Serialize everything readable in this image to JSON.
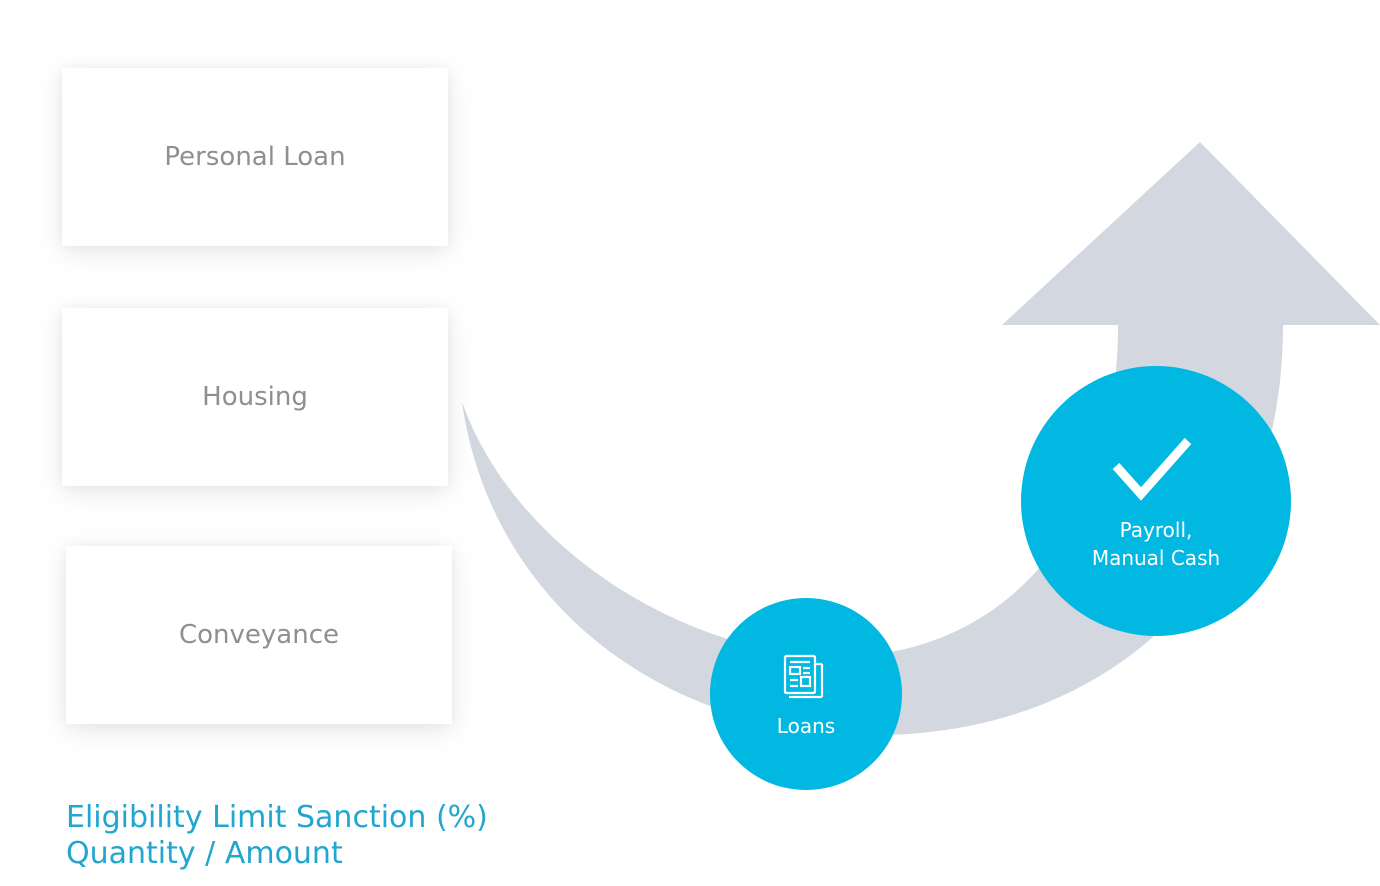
{
  "cards": [
    {
      "label": "Personal Loan"
    },
    {
      "label": "Housing"
    },
    {
      "label": "Conveyance"
    }
  ],
  "caption": {
    "line1": "Eligibility Limit Sanction (%)",
    "line2": "Quantity / Amount"
  },
  "nodes": {
    "loans": {
      "label": "Loans",
      "icon": "document-list-icon"
    },
    "payroll": {
      "line1": "Payroll,",
      "line2": "Manual Cash",
      "icon": "checkmark-icon"
    }
  },
  "colors": {
    "arrow": "#d2d7e0",
    "node": "#00b8e2",
    "card_text": "#8f8f8f",
    "caption": "#21a6cf"
  }
}
